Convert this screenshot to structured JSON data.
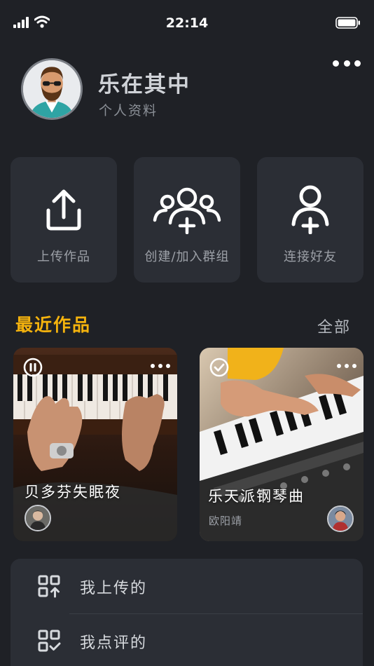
{
  "status_bar": {
    "time": "22:14"
  },
  "profile": {
    "name": "乐在其中",
    "subtitle": "个人资料",
    "avatar_icon": "bearded-man-sunglasses-avatar",
    "more_icon": "more-dots-icon"
  },
  "actions": [
    {
      "label": "上传作品",
      "icon": "upload-icon"
    },
    {
      "label": "创建/加入群组",
      "icon": "group-add-icon"
    },
    {
      "label": "连接好友",
      "icon": "add-friend-icon"
    }
  ],
  "recent": {
    "title": "最近作品",
    "all_label": "全部",
    "accent_color": "#f5b30d",
    "works": [
      {
        "title": "贝多芬失眠夜",
        "artist": "",
        "state_icon": "pause-icon"
      },
      {
        "title": "乐天派钢琴曲",
        "artist": "欧阳靖",
        "state_icon": "check-icon"
      }
    ]
  },
  "list": [
    {
      "label": "我上传的",
      "icon": "grid-upload-icon"
    },
    {
      "label": "我点评的",
      "icon": "grid-check-icon"
    }
  ]
}
